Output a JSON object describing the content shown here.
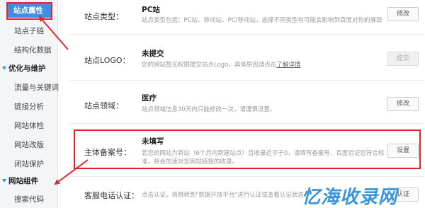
{
  "sidebar": {
    "items": [
      {
        "label": "站点属性"
      },
      {
        "label": "站点子链"
      },
      {
        "label": "结构化数据"
      },
      {
        "label": "优化与维护"
      },
      {
        "label": "流量与关键词"
      },
      {
        "label": "链接分析"
      },
      {
        "label": "网站体检"
      },
      {
        "label": "网站改版"
      },
      {
        "label": "闭站保护"
      },
      {
        "label": "网站组件"
      },
      {
        "label": "搜索代码"
      }
    ]
  },
  "rows": [
    {
      "label": "站点类型：",
      "value": "PC站",
      "desc": "站点类型包括：PC站、移动站、PC/移动站，选择不同类型有可能会影响到百度对你的展现",
      "button": "修改"
    },
    {
      "label": "站点LOGO：",
      "value": "未提交",
      "desc": "您的网站暂无权限提交站点Logo，具体原因请点击",
      "desc_link": "了解详情",
      "button": "提交"
    },
    {
      "label": "站点领域：",
      "value": "医疗",
      "desc": "站点领域信息30天内只能修改一次，请谨慎设置。",
      "button": "修改"
    },
    {
      "label": "主体备案号：",
      "value": "未填写",
      "desc_line1": "若您的网站为新站（6个月内新建站点）且收录近乎于0，请填写备案号，百度验证您符合标",
      "desc_line2": "准，将会加速对您网站链接的收录。",
      "button": "设置"
    },
    {
      "label": "客服电话认证：",
      "desc": "点击认证，将跳转到\"数据开放平台\"进行认证或查看认证状态",
      "button": "认证"
    }
  ],
  "watermark": "忆海收录网",
  "colors": {
    "accent": "#3f8ee6",
    "highlight": "#e0262c",
    "watermark": "#2f8fd8"
  }
}
